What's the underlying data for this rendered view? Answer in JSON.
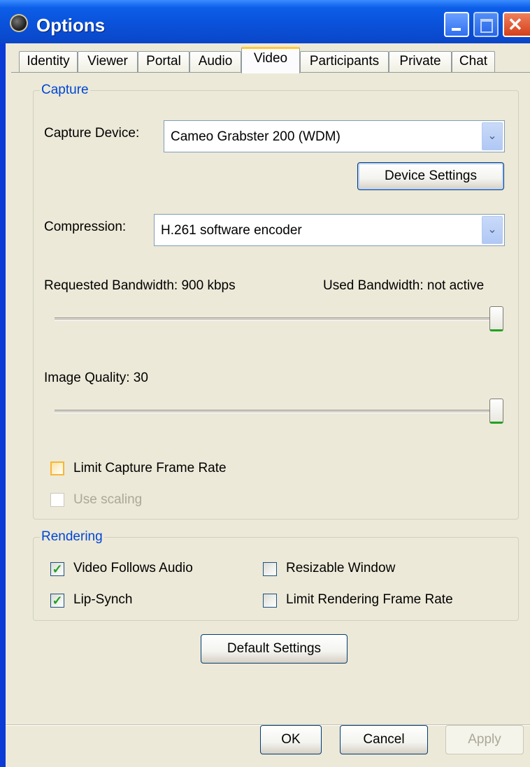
{
  "window": {
    "title": "Options",
    "icon": "app-globe-icon"
  },
  "tabs": [
    {
      "label": "Identity"
    },
    {
      "label": "Viewer"
    },
    {
      "label": "Portal"
    },
    {
      "label": "Audio"
    },
    {
      "label": "Video",
      "active": true
    },
    {
      "label": "Participants"
    },
    {
      "label": "Private"
    },
    {
      "label": "Chat"
    }
  ],
  "capture": {
    "title": "Capture",
    "device_label": "Capture Device:",
    "device_value": "Cameo Grabster 200 (WDM)",
    "device_settings_button": "Device Settings",
    "compression_label": "Compression:",
    "compression_value": "H.261 software encoder",
    "requested_bandwidth": "Requested Bandwidth: 900 kbps",
    "used_bandwidth": "Used Bandwidth: not active",
    "bandwidth_slider_level": 1.0,
    "image_quality": "Image Quality: 30",
    "quality_slider_level": 1.0,
    "limit_frame_rate": {
      "label": "Limit Capture Frame Rate",
      "checked": false
    },
    "use_scaling": {
      "label": "Use scaling",
      "checked": false,
      "enabled": false
    }
  },
  "rendering": {
    "title": "Rendering",
    "video_follows_audio": {
      "label": "Video Follows Audio",
      "checked": true
    },
    "lip_synch": {
      "label": "Lip-Synch",
      "checked": true
    },
    "resizable_window": {
      "label": "Resizable Window",
      "checked": false
    },
    "limit_rendering_frame_rate": {
      "label": "Limit Rendering Frame Rate",
      "checked": false
    }
  },
  "buttons": {
    "default_settings": "Default Settings",
    "ok": "OK",
    "cancel": "Cancel",
    "apply": "Apply"
  },
  "colors": {
    "titlebar": "#0a50d8",
    "group_title": "#0046d5",
    "checkmark": "#21a121",
    "face": "#ece9d8"
  }
}
